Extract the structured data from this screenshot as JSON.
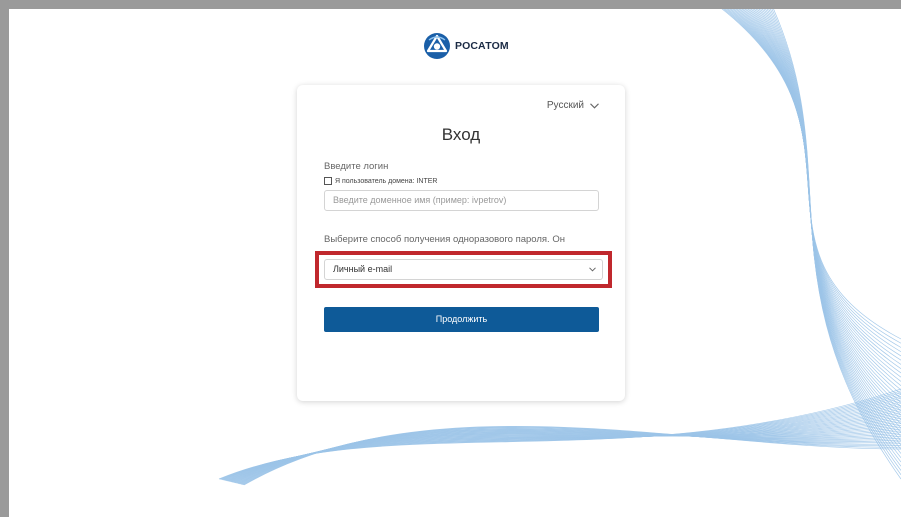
{
  "brand": {
    "name": "РОСАТОМ",
    "logo_icon": "rosatom-logo-icon",
    "accent_color": "#0e5a98",
    "highlight_color": "#c0282d"
  },
  "language": {
    "selected": "Русский",
    "icon": "chevron-down-icon"
  },
  "login_form": {
    "title": "Вход",
    "login_label": "Введите логин",
    "domain_checkbox_label": "Я пользователь домена: INTER",
    "domain_checkbox_checked": false,
    "login_placeholder": "Введите доменное имя (пример: ivpetrov)",
    "login_value": "",
    "otp_label": "Выберите способ получения одноразового пароля. Он",
    "otp_method_selected": "Личный e-mail",
    "continue_label": "Продолжить"
  }
}
